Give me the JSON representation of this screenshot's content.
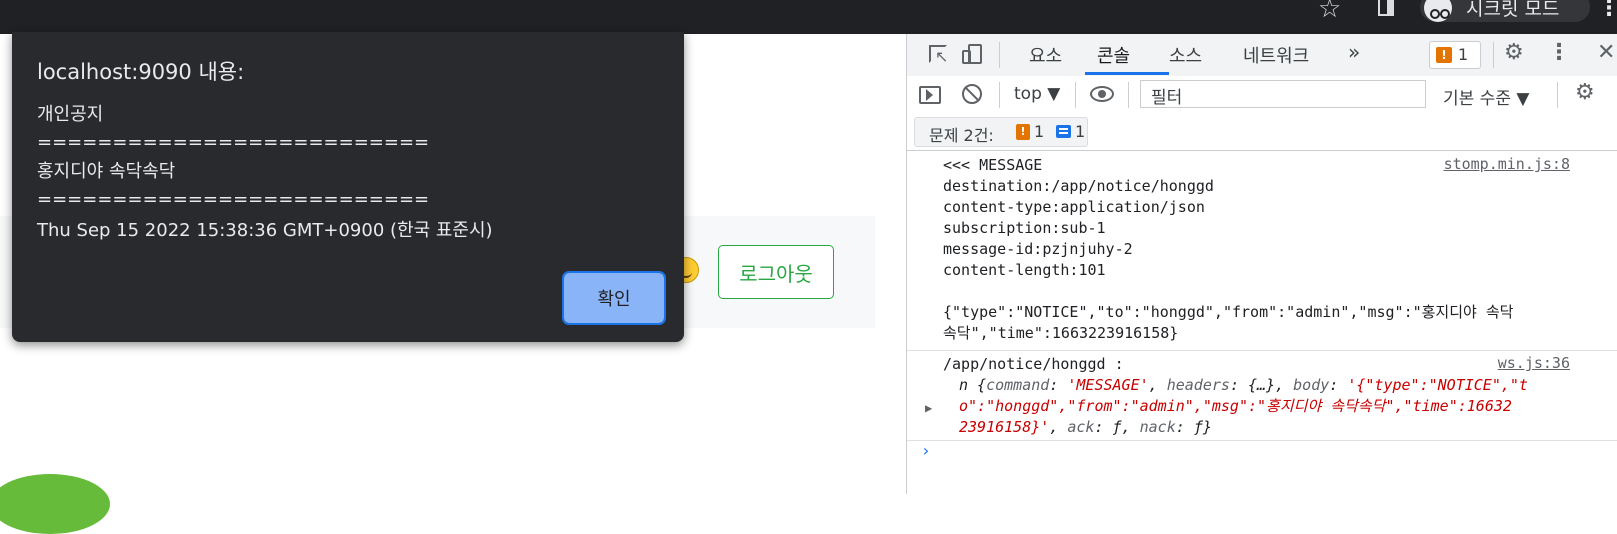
{
  "browser": {
    "incognito_label": "시크릿 모드",
    "star_icon": "star-icon",
    "menu_icon": "kebab-icon"
  },
  "page": {
    "logout_label": "로그아웃",
    "colors": {
      "logout": "#28a745",
      "band": "#f6f8f9"
    }
  },
  "dialog": {
    "title": "localhost:9090 내용:",
    "lines": [
      "개인공지",
      "==========================",
      "홍지디야 속닥속닥",
      "==========================",
      "Thu Sep 15 2022 15:38:36 GMT+0900 (한국 표준시)"
    ],
    "ok_label": "확인",
    "colors": {
      "background": "#292a2d",
      "button": "#8ab4f8"
    }
  },
  "devtools": {
    "tabs": [
      {
        "label": "요소",
        "active": false
      },
      {
        "label": "콘솔",
        "active": true
      },
      {
        "label": "소스",
        "active": false
      },
      {
        "label": "네트워크",
        "active": false
      }
    ],
    "more_tabs": "»",
    "issue_badge_count": "1",
    "toolbar": {
      "context": "top ▼",
      "filter_placeholder": "필터",
      "level": "기본 수준 ▼"
    },
    "issues": {
      "label": "문제 2건:",
      "warnings": "1",
      "infos": "1"
    },
    "console": {
      "message1": {
        "lines": [
          "<<< MESSAGE",
          "destination:/app/notice/honggd",
          "content-type:application/json",
          "subscription:sub-1",
          "message-id:pzjnjuhy-2",
          "content-length:101",
          "",
          "{\"type\":\"NOTICE\",\"to\":\"honggd\",\"from\":\"admin\",\"msg\":\"홍지디야 속닥",
          "속닥\",\"time\":1663223916158}"
        ],
        "source": "stomp.min.js:8"
      },
      "message2": {
        "line1": "/app/notice/honggd :",
        "source": "ws.js:36",
        "obj_prefix": "n {",
        "k_command": "command",
        "v_command": "'MESSAGE'",
        "k_headers": "headers",
        "v_headers": "{…}",
        "k_body": "body",
        "v_body_1": "'{\"type\":\"NOTICE\",\"t",
        "v_body_2": "o\":\"honggd\",\"from\":\"admin\",\"msg\":\"홍지디야 속닥속닥\",\"time\":16632",
        "v_body_3": "23916158}'",
        "k_ack": "ack",
        "v_ack": "ƒ",
        "k_nack": "nack",
        "v_nack": "ƒ"
      },
      "prompt": "›"
    }
  }
}
